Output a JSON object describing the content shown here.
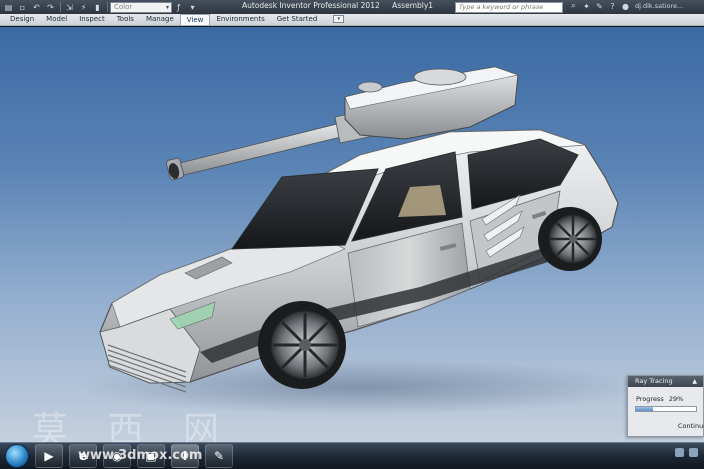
{
  "titlebar": {
    "app_title": "Autodesk Inventor Professional 2012",
    "document": "Assembly1",
    "color_select": "Color",
    "search_placeholder": "Type a keyword or phrase",
    "user": "dj.dik.satiore..."
  },
  "ribbon": {
    "tabs": [
      "Design",
      "Model",
      "Inspect",
      "Tools",
      "Manage",
      "View",
      "Environments",
      "Get Started"
    ],
    "active_tab": "View"
  },
  "ray_tracing": {
    "title": "Ray Tracing",
    "progress_label": "Progress",
    "progress_value": "29%",
    "progress_fraction": 0.29,
    "continue_label": "Continue"
  },
  "watermark": {
    "text": "莫 西 网",
    "url": "www.3dmox.com"
  },
  "colors": {
    "viewport_top": "#3a69a3",
    "viewport_bottom": "#c4d0de",
    "titlebar": "#3a424c"
  },
  "icons": [
    "new-icon",
    "open-icon",
    "save-icon",
    "undo-icon",
    "redo-icon",
    "select-icon",
    "measure-icon",
    "search-icon",
    "help-icon",
    "user-icon",
    "start-orb-icon",
    "ie-icon",
    "chrome-icon",
    "inventor-icon"
  ]
}
